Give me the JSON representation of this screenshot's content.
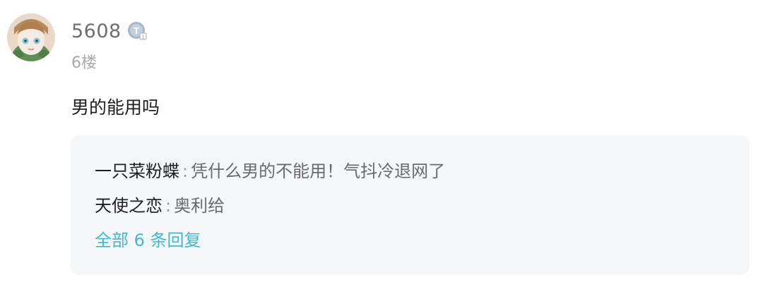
{
  "post": {
    "username": "5608",
    "floor": "6楼",
    "content": "男的能用吗",
    "avatar_icon": "anime-character-avatar",
    "level_badge_icon": "user-level-badge-icon"
  },
  "replies": {
    "items": [
      {
        "author": "一只菜粉蝶",
        "separator": ":",
        "text": "凭什么男的不能用！气抖冷退网了"
      },
      {
        "author": "天使之恋",
        "separator": ":",
        "text": "奥利给"
      }
    ],
    "view_all_label": "全部 6 条回复"
  },
  "colors": {
    "accent": "#3dbad0",
    "reply_background": "#f5f6f8",
    "username": "#6f6f6f",
    "floor": "#a9a9a9"
  }
}
